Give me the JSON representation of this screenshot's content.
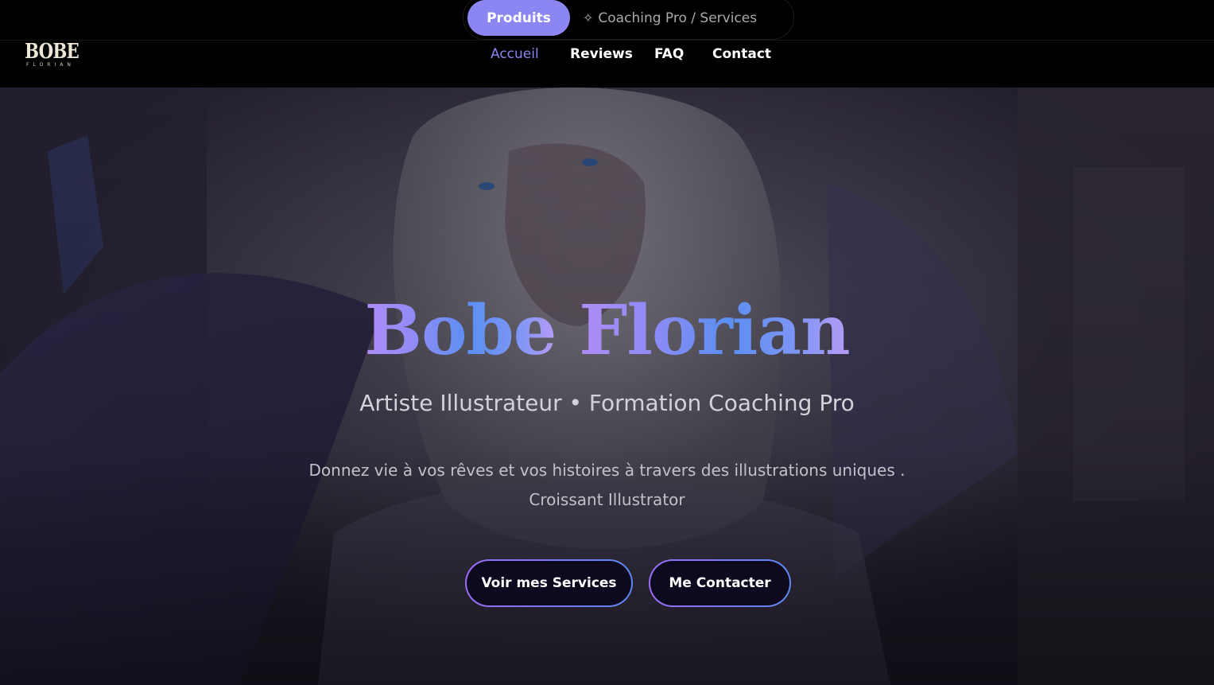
{
  "mode_switch": {
    "products_label": "Produits",
    "coaching_icon": "sparkle-icon",
    "coaching_label": "Coaching Pro / Services"
  },
  "logo": {
    "main": "BOBE",
    "sub": "FLORIAN"
  },
  "nav": {
    "items": [
      {
        "label": "Accueil",
        "active": true
      },
      {
        "label": "Reviews",
        "active": false
      },
      {
        "label": "FAQ",
        "active": false
      },
      {
        "label": "Contact",
        "active": false
      }
    ]
  },
  "hero": {
    "title_first": "Bobe",
    "title_last": "Florian",
    "subtitle": "Artiste Illustrateur • Formation Coaching Pro",
    "description_line1": "Donnez vie à vos rêves et vos histoires à travers des illustrations uniques .",
    "description_line2": "Croissant Illustrator",
    "primary_cta": "Voir mes Services",
    "secondary_cta": "Me Contacter"
  },
  "colors": {
    "accent": "#8b86f2",
    "gradient_start": "#9b6cf3",
    "gradient_end": "#5d88f2",
    "background": "#000000"
  }
}
